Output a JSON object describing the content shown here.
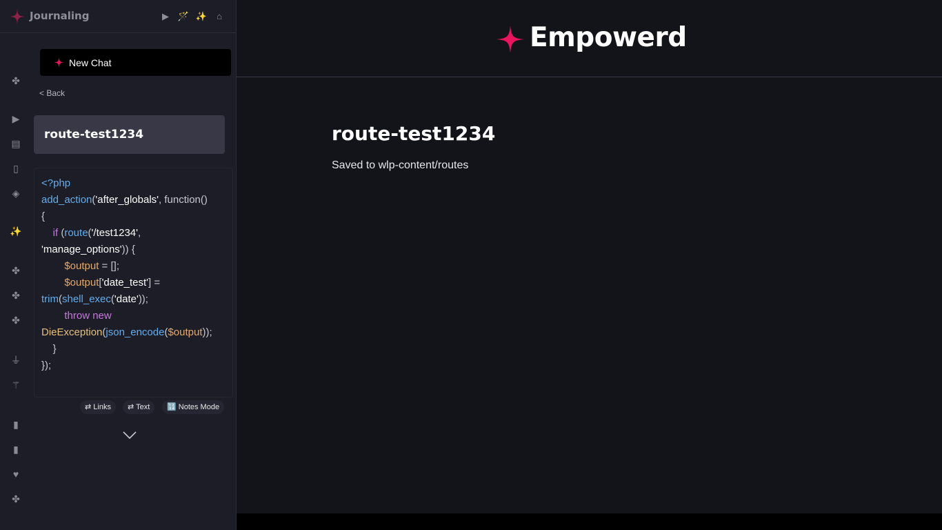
{
  "app": {
    "title": "Journaling",
    "brand": "Empowerd",
    "accent_color": "#e8145e"
  },
  "topbar_icons": [
    "play-icon",
    "magic-wand-icon",
    "sparkles-icon",
    "home-icon"
  ],
  "rail_icons": [
    "puzzle-icon",
    "play-icon",
    "newspaper-icon",
    "document-icon",
    "package-icon",
    "sparkles-icon",
    "puzzle-icon",
    "puzzle-icon",
    "puzzle-icon",
    "plug-icon",
    "magic-wand-icon",
    "database-icon",
    "database-icon",
    "heart-icon",
    "puzzle-icon"
  ],
  "sidebar": {
    "new_chat_label": "New Chat",
    "back_label": "< Back",
    "route_title": "route-test1234",
    "code_language": "php",
    "code_text": "<?php\nadd_action('after_globals', function() {\n    if (route('/test1234', 'manage_options')) {\n        $output = [];\n        $output['date_test'] = trim(shell_exec('date'));\n        throw new DieException(json_encode($output));\n    }\n});",
    "pills": [
      {
        "icon": "⇄",
        "label": "Links"
      },
      {
        "icon": "⇄",
        "label": "Text"
      },
      {
        "icon": "🔢",
        "label": "Notes Mode"
      }
    ]
  },
  "main": {
    "title": "route-test1234",
    "subtitle": "Saved to wlp-content/routes"
  }
}
